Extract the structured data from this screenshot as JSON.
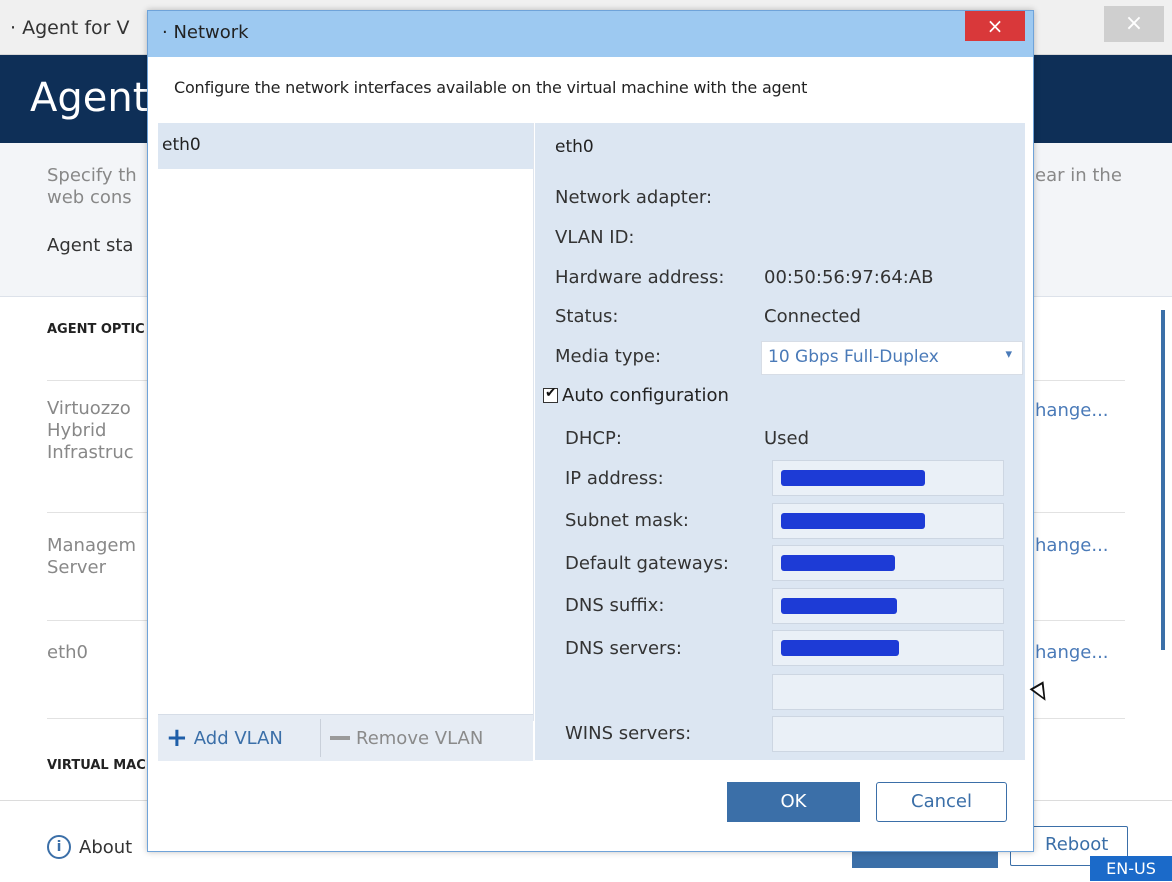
{
  "background_window": {
    "title": "· Agent for V",
    "close_label": "×",
    "header_title": "Agent f",
    "description_left": "Specify th\nweb cons",
    "description_right": "ear in the",
    "agent_status": "Agent sta",
    "section_agent_options": "AGENT OPTIC",
    "rows": [
      {
        "label": "Virtuozzo\nHybrid\nInfrastruc",
        "action": "hange..."
      },
      {
        "label": "Managem\nServer",
        "action": "hange..."
      },
      {
        "label": "eth0",
        "action": "hange..."
      }
    ],
    "section_virtual_machine": "VIRTUAL MAC",
    "about_label": "About",
    "reboot_label": "Reboot",
    "language": "EN-US"
  },
  "dialog": {
    "title": "· Network",
    "close_label": "×",
    "subtitle": "Configure the network interfaces available on the virtual machine with the agent",
    "interfaces": [
      {
        "name": "eth0",
        "selected": true
      }
    ],
    "add_vlan_label": "Add VLAN",
    "remove_vlan_label": "Remove VLAN",
    "details": {
      "heading": "eth0",
      "network_adapter_label": "Network adapter:",
      "vlan_id_label": "VLAN ID:",
      "hardware_address_label": "Hardware address:",
      "hardware_address_value": "00:50:56:97:64:AB",
      "status_label": "Status:",
      "status_value": "Connected",
      "media_type_label": "Media type:",
      "media_type_value": "10 Gbps Full-Duplex",
      "auto_configuration_label": "Auto configuration",
      "auto_configuration_checked": true,
      "dhcp_label": "DHCP:",
      "dhcp_value": "Used",
      "ip_address_label": "IP address:",
      "subnet_mask_label": "Subnet mask:",
      "default_gateways_label": "Default gateways:",
      "dns_suffix_label": "DNS suffix:",
      "dns_servers_label": "DNS servers:",
      "wins_servers_label": "WINS servers:"
    },
    "ok_label": "OK",
    "cancel_label": "Cancel"
  },
  "colors": {
    "header_navy": "#0e2f57",
    "accent_blue": "#3b6fa8",
    "dialog_titlebar": "#9dc9f1",
    "close_red": "#d9383a",
    "details_panel": "#dce6f2",
    "redaction": "#1d3bd6"
  }
}
